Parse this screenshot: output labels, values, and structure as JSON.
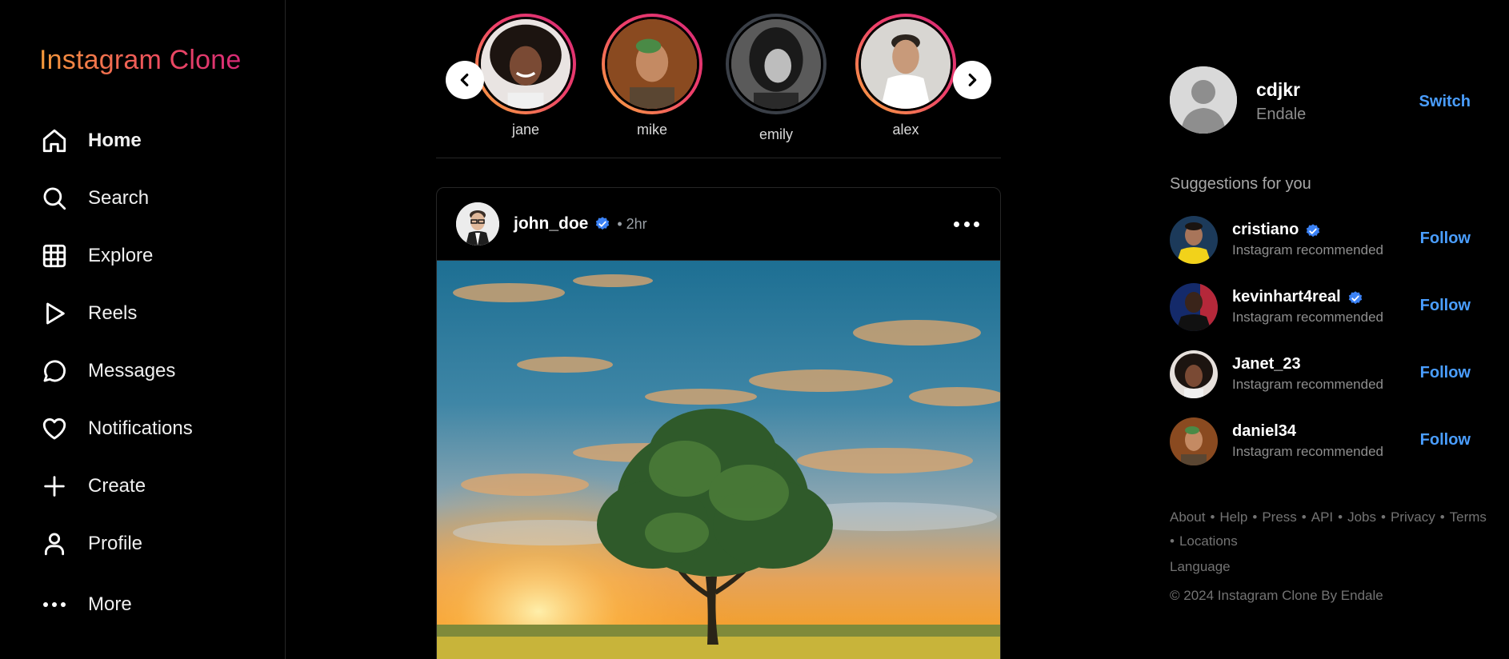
{
  "app": {
    "logo": "Instagram Clone"
  },
  "sidebar": {
    "items": [
      {
        "label": "Home",
        "icon": "home-icon",
        "active": true
      },
      {
        "label": "Search",
        "icon": "search-icon"
      },
      {
        "label": "Explore",
        "icon": "grid-icon"
      },
      {
        "label": "Reels",
        "icon": "play-icon"
      },
      {
        "label": "Messages",
        "icon": "chat-icon"
      },
      {
        "label": "Notifications",
        "icon": "heart-icon"
      },
      {
        "label": "Create",
        "icon": "plus-icon"
      },
      {
        "label": "Profile",
        "icon": "user-icon"
      }
    ],
    "more": {
      "label": "More",
      "icon": "more-dots-icon"
    }
  },
  "stories": [
    {
      "name": "jane",
      "seen": false
    },
    {
      "name": "mike",
      "seen": false
    },
    {
      "name": "emily",
      "seen": true
    },
    {
      "name": "alex",
      "seen": false
    }
  ],
  "post": {
    "username": "john_doe",
    "verified": true,
    "time": "• 2hr"
  },
  "current_user": {
    "username": "cdjkr",
    "full_name": "Endale",
    "switch_label": "Switch"
  },
  "suggestions": {
    "title": "Suggestions for you",
    "items": [
      {
        "username": "cristiano",
        "verified": true,
        "subtitle": "Instagram recommended",
        "action": "Follow"
      },
      {
        "username": "kevinhart4real",
        "verified": true,
        "subtitle": "Instagram recommended",
        "action": "Follow"
      },
      {
        "username": "Janet_23",
        "verified": false,
        "subtitle": "Instagram recommended",
        "action": "Follow"
      },
      {
        "username": "daniel34",
        "verified": false,
        "subtitle": "Instagram recommended",
        "action": "Follow"
      }
    ]
  },
  "footer": {
    "links": [
      "About",
      "Help",
      "Press",
      "API",
      "Jobs",
      "Privacy",
      "Terms",
      "Locations"
    ],
    "language": "Language",
    "copyright": "© 2024 Instagram Clone By Endale"
  },
  "colors": {
    "accent": "#4a9eff",
    "verified": "#3b82f6",
    "background": "#000000"
  }
}
